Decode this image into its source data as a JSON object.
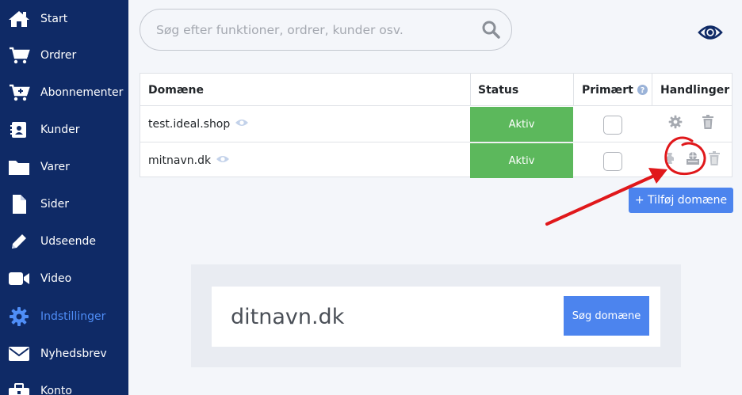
{
  "sidebar": {
    "items": [
      {
        "label": "Start",
        "icon": "home-icon"
      },
      {
        "label": "Ordrer",
        "icon": "cart-icon"
      },
      {
        "label": "Abonnementer",
        "icon": "cart-plus-icon"
      },
      {
        "label": "Kunder",
        "icon": "contact-card-icon"
      },
      {
        "label": "Varer",
        "icon": "folder-icon"
      },
      {
        "label": "Sider",
        "icon": "file-icon"
      },
      {
        "label": "Udseende",
        "icon": "pencil-icon"
      },
      {
        "label": "Video",
        "icon": "video-camera-icon"
      },
      {
        "label": "Indstillinger",
        "icon": "gear-icon",
        "active": true
      },
      {
        "label": "Nyhedsbrev",
        "icon": "envelope-icon"
      },
      {
        "label": "Konto",
        "icon": "briefcase-icon"
      }
    ]
  },
  "search": {
    "placeholder": "Søg efter funktioner, ordrer, kunder osv.",
    "value": ""
  },
  "table": {
    "headers": {
      "domain": "Domæne",
      "status": "Status",
      "primary": "Primært",
      "actions": "Handlinger"
    },
    "rows": [
      {
        "domain": "test.ideal.shop",
        "status": "Aktiv",
        "primary": false
      },
      {
        "domain": "mitnavn.dk",
        "status": "Aktiv",
        "primary": false
      }
    ]
  },
  "add_domain_label": "+ Tilføj domæne",
  "domain_search": {
    "value": "ditnavn.dk",
    "button_label": "Søg domæne"
  },
  "colors": {
    "sidebar_bg": "#0f2a66",
    "active_item": "#4f8ef7",
    "status_active": "#5cb85c",
    "primary_button": "#4c84ee",
    "annotation": "#e0181b"
  }
}
